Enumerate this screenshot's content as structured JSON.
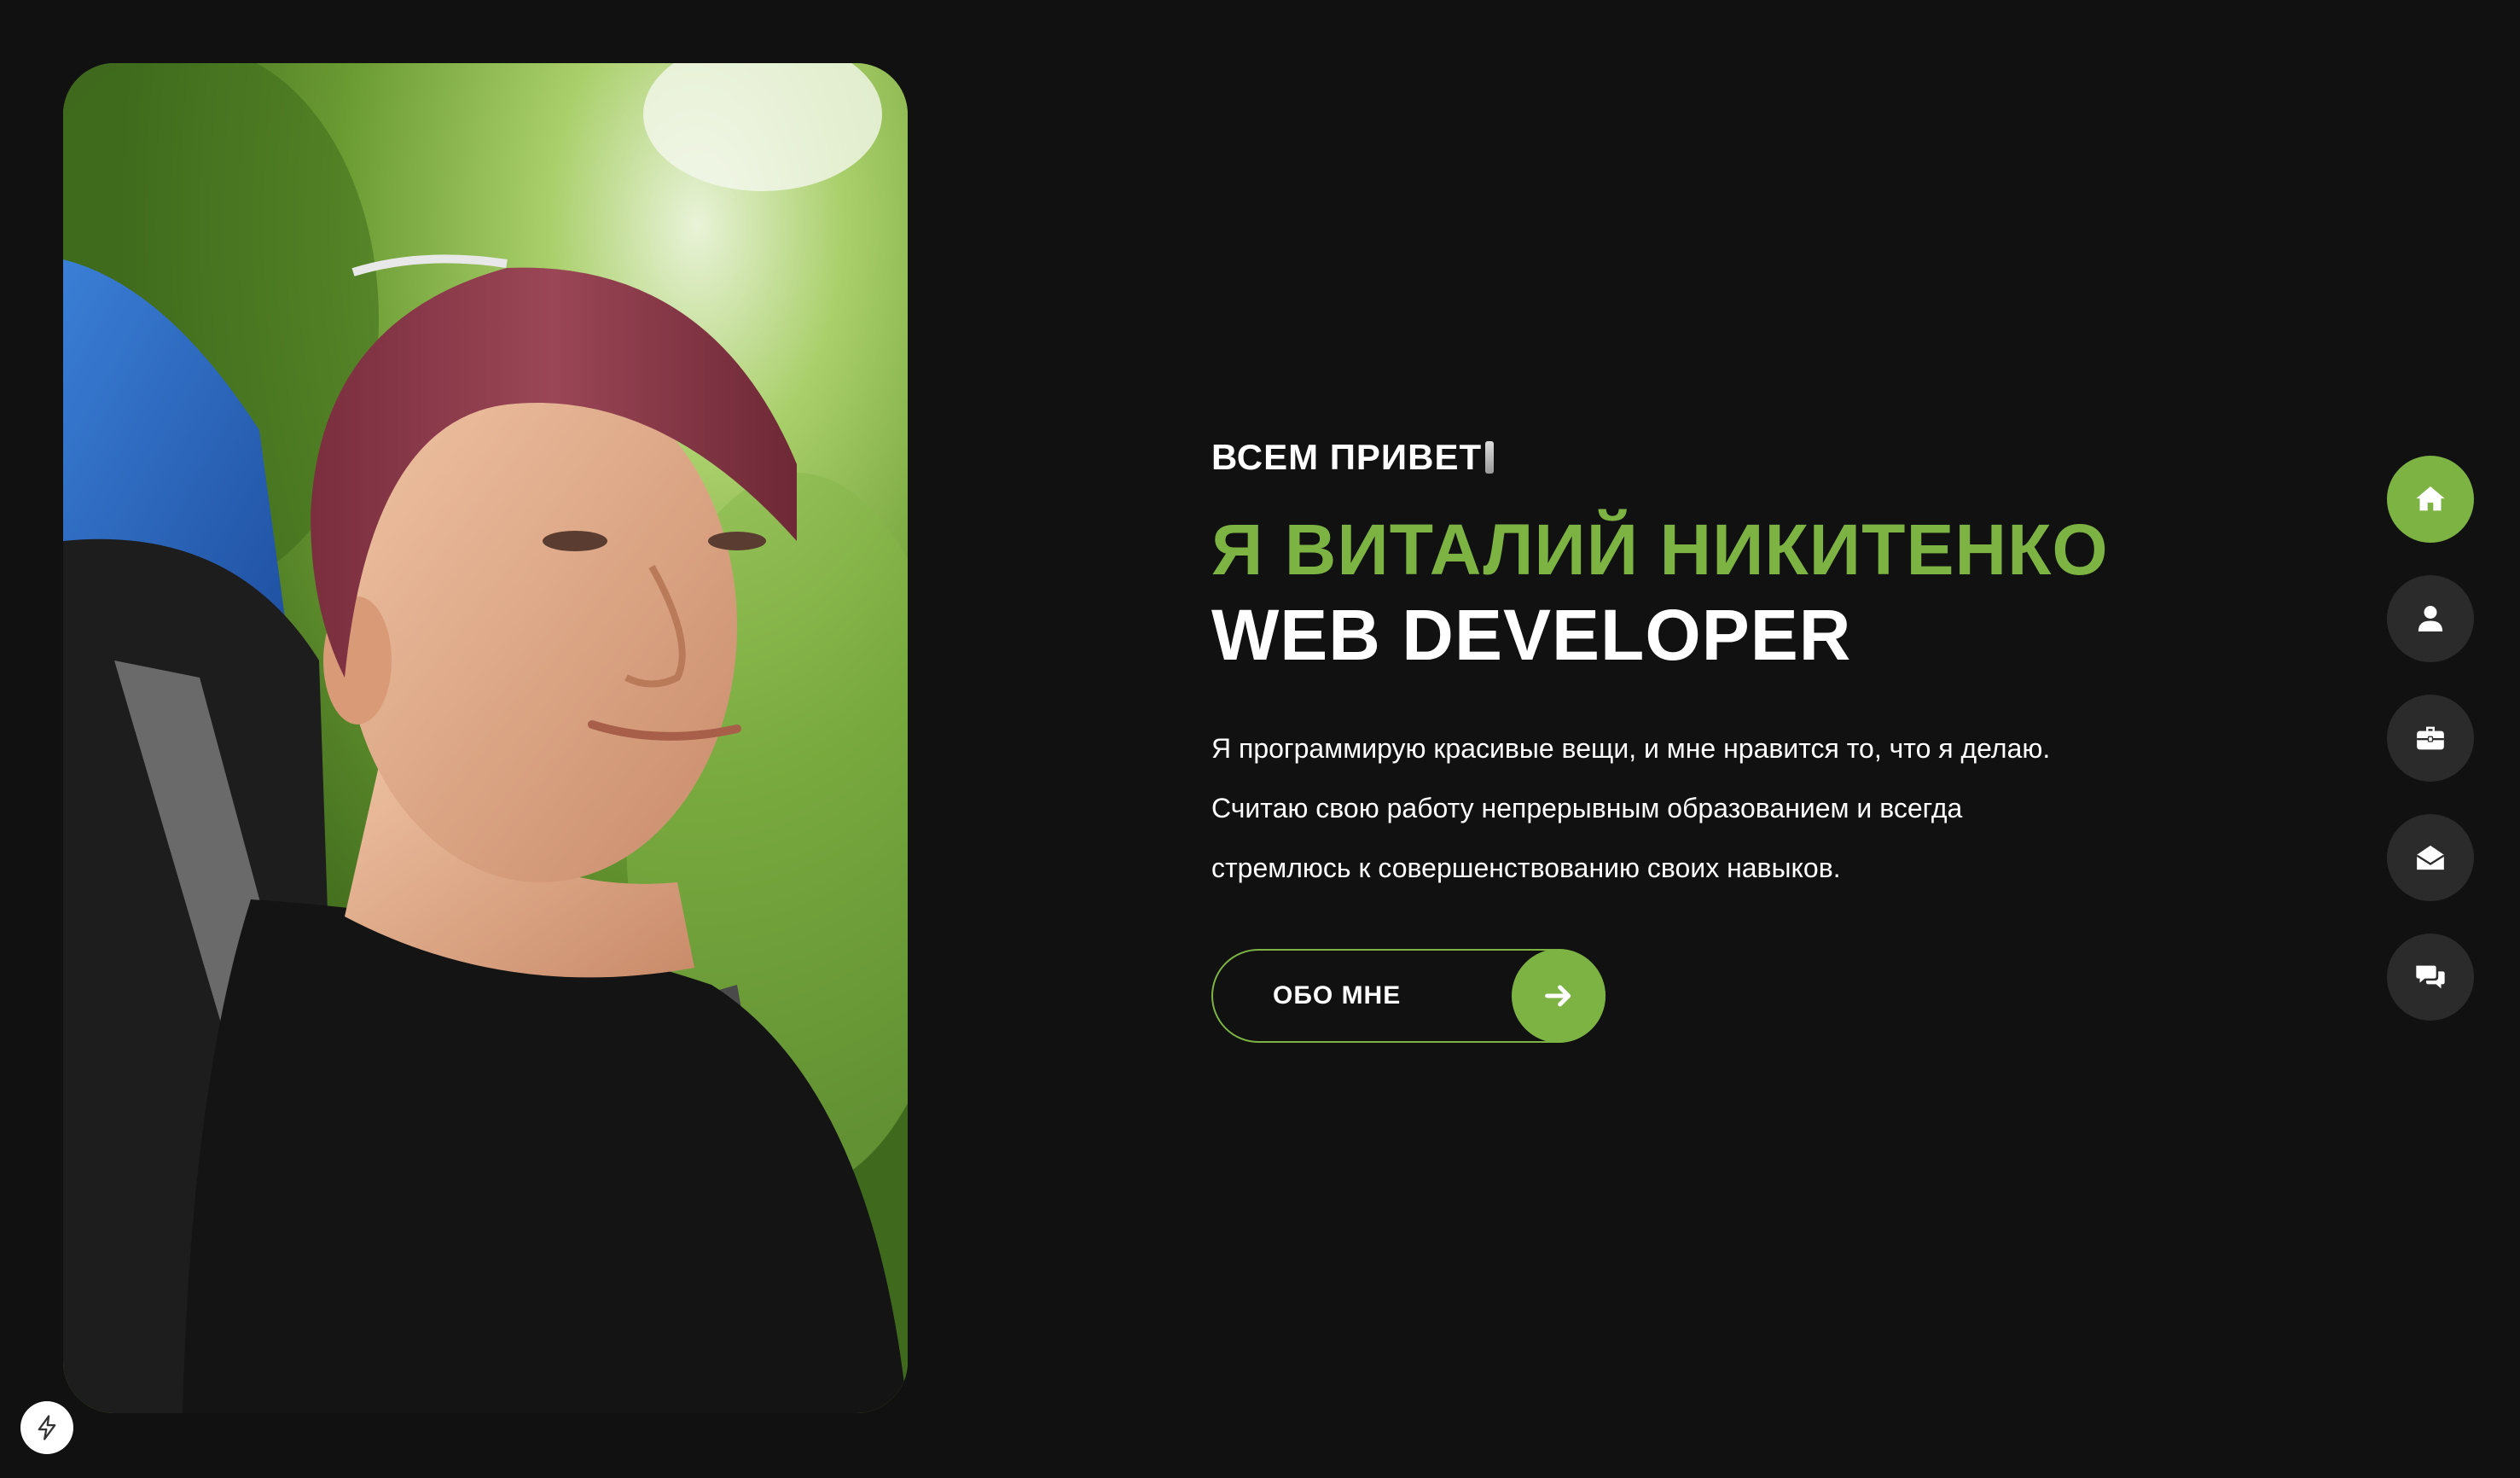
{
  "hero": {
    "greeting": "ВСЕМ ПРИВЕТ",
    "name": "Я ВИТАЛИЙ НИКИТЕНКО",
    "role": "WEB DEVELOPER",
    "bio_lines": [
      "Я программирую красивые вещи, и мне нравится то, что я делаю.",
      "Считаю свою работу непрерывным образованием и всегда",
      "стремлюсь к совершенствованию своих навыков."
    ],
    "about_button_label": "ОБО МНЕ"
  },
  "side_nav": {
    "items": [
      {
        "icon": "home-icon",
        "active": true
      },
      {
        "icon": "user-icon",
        "active": false
      },
      {
        "icon": "briefcase-icon",
        "active": false
      },
      {
        "icon": "envelope-open-icon",
        "active": false
      },
      {
        "icon": "comments-icon",
        "active": false
      }
    ]
  },
  "badge": {
    "icon": "lightning-icon"
  },
  "colors": {
    "background": "#111111",
    "accent": "#7cb342",
    "nav_button": "#2b2b2b",
    "text": "#ffffff"
  }
}
